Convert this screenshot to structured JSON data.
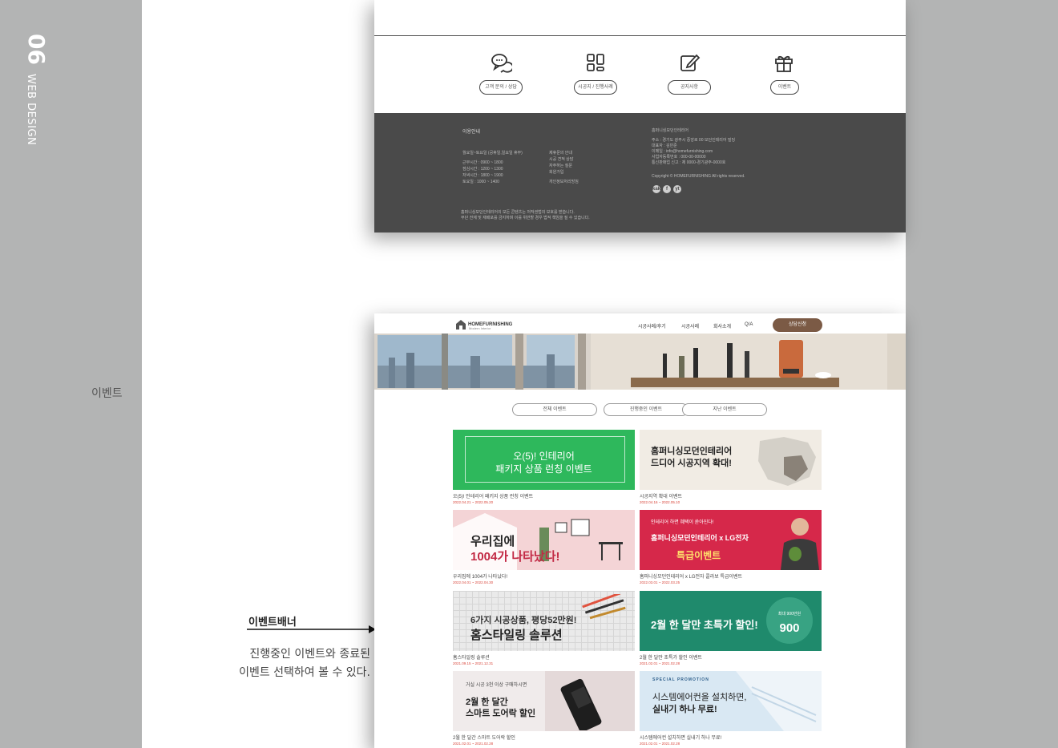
{
  "sidebar": {
    "number": "06",
    "label": "WEB DESIGN"
  },
  "section_label": "이벤트",
  "annotation": {
    "title": "이벤트배너",
    "desc_line1": "진행중인 이벤트와 종료된",
    "desc_line2": "이벤트 선택하여 볼 수 있다."
  },
  "footer_mock": {
    "services": [
      {
        "icon": "chat-bubbles-icon",
        "label": "고객 문의 / 상담"
      },
      {
        "icon": "grid-icon",
        "label": "시공지 / 진행사례"
      },
      {
        "icon": "edit-icon",
        "label": "공지사항"
      },
      {
        "icon": "gift-icon",
        "label": "이벤트"
      }
    ],
    "guide_title": "이용안내",
    "hours_title": "월요일~토요일 (공휴일,일요일 휴무)",
    "hours": [
      "근무시간 : 0900 ~ 1800",
      "점심시간 : 1200 ~ 1300",
      "저녁시간 : 1800 ~ 1900",
      "토요일 : 1000 ~ 1400"
    ],
    "links": [
      "제휴문의 안내",
      "시공 견적 상담",
      "자주하는 질문",
      "회원가입",
      "개인정보처리방침"
    ],
    "company_title": "홈퍼니싱모던인테리어",
    "company_lines": [
      "주소 : 경기도 광주시 중앙로 00 모던인테리어 빌딩",
      "대표자 : 김민준",
      "이메일 : info@homefurnishing.com",
      "사업자등록번호 : 000-00-00000",
      "통신판매업 신고 : 제 0000-경기광주-0000호"
    ],
    "copyright": "Copyright © HOMEFURNISHING All rights reserved.",
    "social": [
      "kakao",
      "f",
      "yt"
    ],
    "notice": [
      "홈퍼니싱모던인테리어의 모든 콘텐츠는 저작권법의 보호를 받습니다.",
      "무단 전재 및 재배포를 금지하며 이를 위반할 경우 법적 책임을 질 수 있습니다."
    ]
  },
  "event_page": {
    "logo": "HOMEFURNISHING",
    "logo_sub": "Modern Interior",
    "nav": [
      "시공사례/후기",
      "시공사례",
      "회사소개",
      "Q/A"
    ],
    "cta": "상담신청",
    "tabs": [
      "전체 이벤트",
      "진행중인 이벤트",
      "지난 이벤트"
    ],
    "cards": [
      {
        "line1": "오(5)! 인테리어",
        "line2": "패키지 상품 런칭 이벤트",
        "caption": "오(5)! 인테리어 패키지 상품 런칭 이벤트",
        "date": "2022.04.21 ~ 2022.05.20"
      },
      {
        "line1": "홈퍼니싱모던인테리어",
        "line2": "드디어 시공지역 확대!",
        "caption": "시공지역 확대 이벤트",
        "date": "2022.04.16 ~ 2022.05.10"
      },
      {
        "line1": "우리집에",
        "line2": "1004가 나타났다!",
        "caption": "우리집에 1004가 나타났다!",
        "date": "2022.04.01 ~ 2022.04.30"
      },
      {
        "line1": "홈퍼니싱모던인테리어 x LG전자",
        "line2": "특급이벤트",
        "caption": "홈퍼니싱모던인테리어 x LG전자 콜라보 특급이벤트",
        "date": "2022.03.01 ~ 2022.03.25"
      },
      {
        "line1": "6가지 시공상품, 평당52만원!",
        "line2": "홈스타일링 솔루션",
        "caption": "홈스타일링 솔루션",
        "date": "2021.09.15 ~ 2021.12.31"
      },
      {
        "line1": "2월 한 달만 초특가 할인!",
        "line2": "900",
        "caption": "2월 한 달만 초특가 할인 이벤트",
        "date": "2021.02.01 ~ 2021.02.28"
      },
      {
        "line1": "2월 한 달간",
        "line2": "스마트 도어락 할인",
        "caption": "2월 한 달간 스마트 도어락 할인",
        "date": "2021.02.01 ~ 2021.02.28"
      },
      {
        "line1": "시스템에어컨을 설치하면,",
        "line2": "실내기 하나 무료!",
        "caption": "시스템에어컨 설치하면 실내기 하나 무료!",
        "date": "2021.02.01 ~ 2021.02.28"
      }
    ],
    "card_extras": {
      "c3_kicker": "인테리어 하면 혜택이 쏟아진다!",
      "c6_badge": "최대 900만원",
      "c7_kicker": "거실 시공 3천 이상 구매하시면",
      "c8_kicker": "SPECIAL PROMOTION"
    }
  },
  "colors": {
    "page_bg": "#b3b4b4",
    "footer_bg": "#4a4a4a",
    "cta_brown": "#7b5a45",
    "date_red": "#d9473c",
    "banner_green": "#2eb85c",
    "banner_pink": "#f4d4d6",
    "banner_red": "#d6284a",
    "banner_teal": "#1f8a6c",
    "banner_gray": "#eaeaea",
    "banner_blue": "#d9e8f3"
  }
}
